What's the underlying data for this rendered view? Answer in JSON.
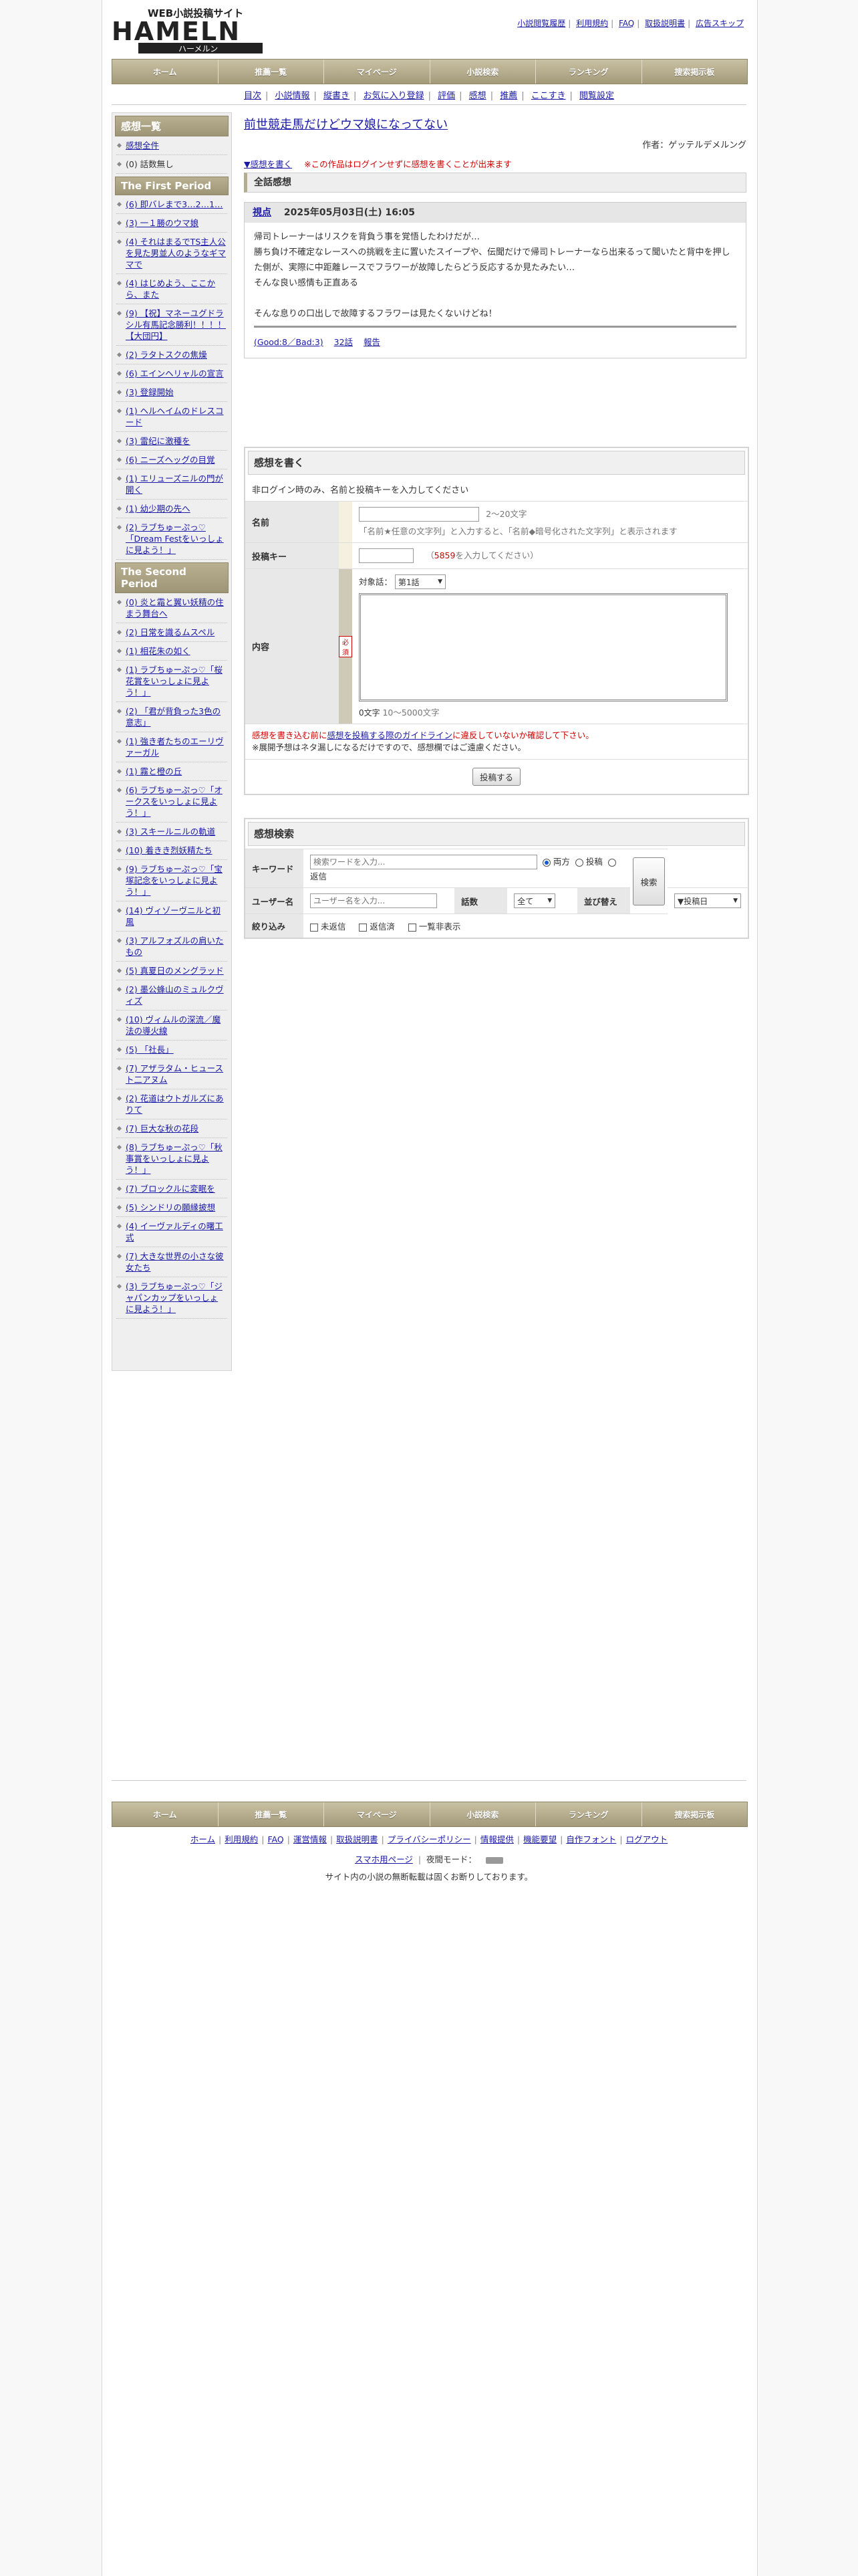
{
  "header": {
    "logo": {
      "top": "WEB小説投稿サイト",
      "main": "HAMELN",
      "sub": "ハーメルン"
    },
    "links": [
      "小説閲覧履歴",
      "利用規約",
      "FAQ",
      "取扱説明書",
      "広告スキップ"
    ]
  },
  "gnav": [
    "ホーム",
    "推薦一覧",
    "マイページ",
    "小説検索",
    "ランキング",
    "捜索掲示板"
  ],
  "subnav": [
    "目次",
    "小説情報",
    "縦書き",
    "お気に入り登録",
    "評価",
    "感想",
    "推薦",
    "ここすき",
    "閲覧設定"
  ],
  "sidebar": {
    "heading": "感想一覧",
    "top_items": [
      {
        "label": "感想全件",
        "link": true
      },
      {
        "label": "(0) 話数無し",
        "link": false
      }
    ],
    "period1": "The First Period",
    "period1_items": [
      "(6) 即バレまで3…2…1…",
      "(3) 一１勝のウマ娘",
      "(4) それはまるでTS主人公を見た男並人のようなギママで",
      "(4) はじめよう、ここから、また",
      "(9) 【祝】マネーユグドラシル有馬記念勝利！！！！【大団円】",
      "(2) ラタトスクの焦燥",
      "(6) エインヘリャルの宣言",
      "(3) 登録開始",
      "(1) ヘルヘイムのドレスコード",
      "(3) 雷纪に激種を",
      "(6) ニーズヘッグの目覚",
      "(1) エリューズニルの門が開く",
      "(1) 幼少期の先へ",
      "(2) ラブちゅーぷっ♡「Dream Festをいっしょに見よう！」"
    ],
    "period2": "The Second Period",
    "period2_items": [
      "(0) 炎と霜と翼い妖精の住まう舞台へ",
      "(2) 日常を識るムスペル",
      "(1) 相花朱の如く",
      "(1) ラブちゅーぷっ♡「桜花賞をいっしょに見よう！」",
      "(2) 「君が背負った3色の意志」",
      "(1) 強き者たちのエーリヴァーガル",
      "(1) 霧と橙の丘",
      "(6) ラブちゅーぷっ♡「オークスをいっしょに見よう！」",
      "(3) スキールニルの軌道",
      "(10) 着きき烈妖精たち",
      "(9) ラブちゅーぷっ♡「宝塚記念をいっしょに見よう！」",
      "(14) ヴィゾーヴニルと初風",
      "(3) アルフォズルの肩いたもの",
      "(5) 真夏日のメングラッド",
      "(2) 墨公蜂山のミュルクヴィズ",
      "(10) ヴィムルの深流／魔法の導火線",
      "(5) 「社長」",
      "(7) アザラタム・ヒュースト二アヌム",
      "(2) 花道はウトガルズにありて",
      "(7) 巨大な秋の花段",
      "(8) ラブちゅーぷっ♡「秋事賞をいっしょに見よう！」",
      "(7) ブロックルに変眠を",
      "(5) シンドリの願縁披想",
      "(4) イーヴァルディの曙工式",
      "(7) 大きな世界の小さな彼女たち",
      "(3) ラブちゅーぷっ♡「ジャパンカップをいっしょに見よう！」"
    ]
  },
  "main": {
    "title": "前世競走馬だけどウマ娘になってない",
    "author": "作者：ゲッテルデメルング",
    "write_link": "▼感想を書く",
    "login_warning": "※この作品はログインせずに感想を書くことが出来ます",
    "section_title": "全話感想",
    "impression": {
      "user": "視点",
      "date": "2025年05月03日(土) 16:05",
      "lines": [
        "帰司トレーナーはリスクを背負う事を覚悟したわけだが…",
        "勝ち負け不確定なレースへの挑戦を主に置いたスイープや、伝聞だけで帰司トレーナーなら出来るって聞いたと背中を押した側が、実際に中距離レースでフラワーが故障したらどう反応するか見たみたい…",
        "そんな良い感情も正直ある",
        "",
        "そんな息りの口出しで故障するフラワーは見たくないけどね！"
      ],
      "good_bad": "(Good:8／Bad:3)",
      "episode": "32話",
      "report": "報告"
    }
  },
  "form": {
    "title": "感想を書く",
    "intro": "非ログイン時のみ、名前と投稿キーを入力してください",
    "name_label": "名前",
    "name_hint": "2～20文字",
    "name_note": "「名前★任意の文字列」と入力すると、「名前◆暗号化された文字列」と表示されます",
    "key_label": "投稿キー",
    "key_code": "5859",
    "key_hint": "を入力してください",
    "content_label": "内容",
    "content_badge": "必須",
    "target_label": "対象話：",
    "target_value": "第1話",
    "char_count": "0文字",
    "char_limit": "10～5000文字",
    "guideline_pre": "感想を書き込む前に",
    "guideline_link": "感想を投稿する際のガイドライン",
    "guideline_post": "に違反していないか確認して下さい。",
    "spoiler_note": "※展開予想はネタ漏しになるだけですので、感想欄ではご遠慮ください。",
    "submit": "投稿する"
  },
  "search": {
    "title": "感想検索",
    "keyword_label": "キーワード",
    "keyword_placeholder": "検索ワードを入力...",
    "radio": [
      "両方",
      "投稿",
      "返信"
    ],
    "user_label": "ユーザー名",
    "user_placeholder": "ユーザー名を入力...",
    "episode_label": "話数",
    "episode_value": "全て",
    "sort_label": "並び替え",
    "sort_value": "▼投稿日",
    "filter_label": "絞り込み",
    "filters": [
      "未返信",
      "返信済",
      "一覧非表示"
    ],
    "button": "検索"
  },
  "footer": {
    "links": [
      "ホーム",
      "利用規約",
      "FAQ",
      "運営情報",
      "取扱説明書",
      "プライバシーポリシー",
      "情報提供",
      "機能要望",
      "自作フォント",
      "ログアウト"
    ],
    "sp_link": "スマホ用ページ",
    "night": "夜間モード：",
    "copyright": "サイト内の小説の無断転載は固くお断りしております。"
  }
}
